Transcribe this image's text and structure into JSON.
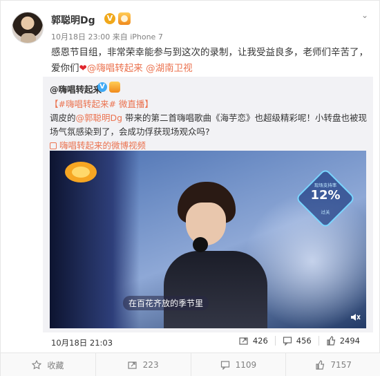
{
  "post": {
    "username": "郭聪明Dg",
    "verified_mark": "V",
    "timestamp": "10月18日 23:00",
    "source": "来自 iPhone 7",
    "text_main": "感恩节目组，非常荣幸能参与到这次的录制，让我受益良多，老师们辛苦了，爱你们",
    "mention_1": "@嗨唱转起来",
    "mention_2": "@湖南卫视"
  },
  "repost": {
    "username": "@嗨唱转起来",
    "verified_mark": "V",
    "hashtag": "【#嗨唱转起来# 微直播】",
    "line_prefix": "调皮的",
    "mention": "@郭聪明Dg",
    "line_body": " 带来的第二首嗨唱歌曲《海芋恋》也超级精彩呢！小转盘也被现场气氛感染到了，会成功俘获现场观众吗?",
    "source_link": "嗨唱转起来的微博视频",
    "timestamp": "10月18日 21:03",
    "stats": {
      "reposts": "426",
      "comments": "456",
      "likes": "2494"
    }
  },
  "video": {
    "approval_title": "现场支持率",
    "approval_value": "12%",
    "approval_sub": "过关",
    "lyric": "在百花齐放的季节里"
  },
  "footer": {
    "favorite_label": "收藏",
    "repost_count": "223",
    "comment_count": "1109",
    "like_count": "7157"
  },
  "colors": {
    "link": "#eb7350",
    "badge_gold": "#f0a81b",
    "badge_blue": "#3fa9f5"
  }
}
